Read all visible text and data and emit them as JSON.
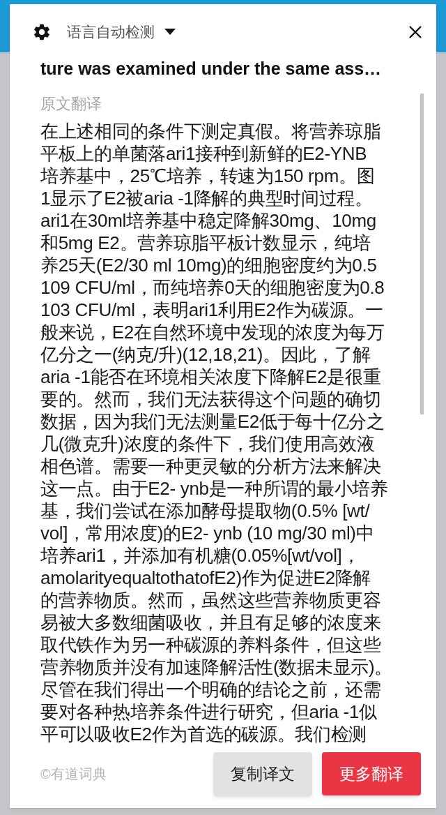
{
  "header": {
    "language": "语言自动检测"
  },
  "source_text": "ture was examined under the same ass…",
  "section_label": "原文翻译",
  "translation_lines": [
    "在上述相同的条件下测定真假。将营养琼脂",
    "平板上的单菌落ari1接种到新鲜的E2-YNB",
    "培养基中，25℃培养，转速为150 rpm。图",
    "1显示了E2被aria -1降解的典型时间过程。",
    "ari1在30ml培养基中稳定降解30mg、10mg",
    "和5mg E2。营养琼脂平板计数显示，纯培",
    "养25天(E2/30 ml 10mg)的细胞密度约为0.5",
    "109 CFU/ml，而纯培养0天的细胞密度为0.8",
    "103 CFU/ml，表明ari1利用E2作为碳源。一",
    "般来说，E2在自然环境中发现的浓度为每万",
    "亿分之一(纳克/升)(12,18,21)。因此，了解",
    "aria -1能否在环境相关浓度下降解E2是很重",
    "要的。然而，我们无法获得这个问题的确切",
    "数据，因为我们无法测量E2低于每十亿分之",
    "几(微克升)浓度的条件下，我们使用高效液",
    "相色谱。需要一种更灵敏的分析方法来解决",
    "这一点。由于E2- ynb是一种所谓的最小培养",
    "基，我们尝试在添加酵母提取物(0.5% [wt/",
    "vol]，常用浓度)的E2- ynb (10 mg/30 ml)中",
    "培养ari1，并添加有机糖(0.05%[wt/vol]，",
    "amolarityequaltothatofE2)作为促进E2降解",
    "的营养物质。然而，虽然这些营养物质更容",
    "易被大多数细菌吸收，并且有足够的浓度来",
    "取代铁作为另一种碳源的养料条件，但这些",
    "营养物质并没有加速降解活性(数据未显示)。",
    "尽管在我们得出一个明确的结论之前，还需",
    "要对各种热培养条件进行研究，但aria -1似",
    "平可以吸收E2作为首选的碳源。我们检测"
  ],
  "footer": {
    "credit": "©有道词典",
    "buttons": [
      {
        "label": "复制译文",
        "kind": "secondary"
      },
      {
        "label": "更多翻译",
        "kind": "primary"
      }
    ]
  }
}
